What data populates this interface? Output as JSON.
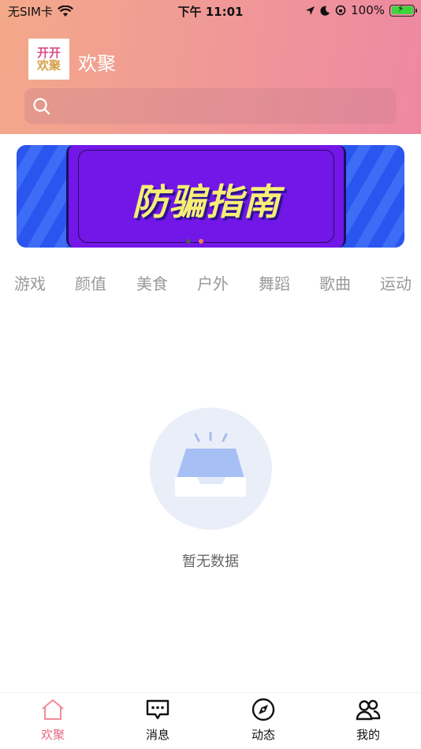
{
  "status_bar": {
    "carrier": "无SIM卡",
    "time": "下午 11:01",
    "battery": "100%"
  },
  "header": {
    "logo_line1": "开开",
    "logo_line2": "欢聚",
    "title": "欢聚",
    "search_placeholder": "",
    "gradient": [
      "#f4a98a",
      "#ee88a2"
    ]
  },
  "banner": {
    "text": "防骗指南",
    "page_count": 2,
    "active_index": 1,
    "dot_color": "#555555",
    "dot_active_color": "#f07a5a"
  },
  "categories": [
    "游戏",
    "颜值",
    "美食",
    "户外",
    "舞蹈",
    "歌曲",
    "运动"
  ],
  "empty_state": {
    "message": "暂无数据",
    "icon": "inbox-icon"
  },
  "tabbar": {
    "items": [
      {
        "label": "欢聚",
        "icon": "home-icon",
        "active": true
      },
      {
        "label": "消息",
        "icon": "message-icon",
        "active": false
      },
      {
        "label": "动态",
        "icon": "compass-icon",
        "active": false
      },
      {
        "label": "我的",
        "icon": "profile-icon",
        "active": false
      }
    ],
    "active_color": "#e8697e",
    "inactive_color": "#111111"
  }
}
